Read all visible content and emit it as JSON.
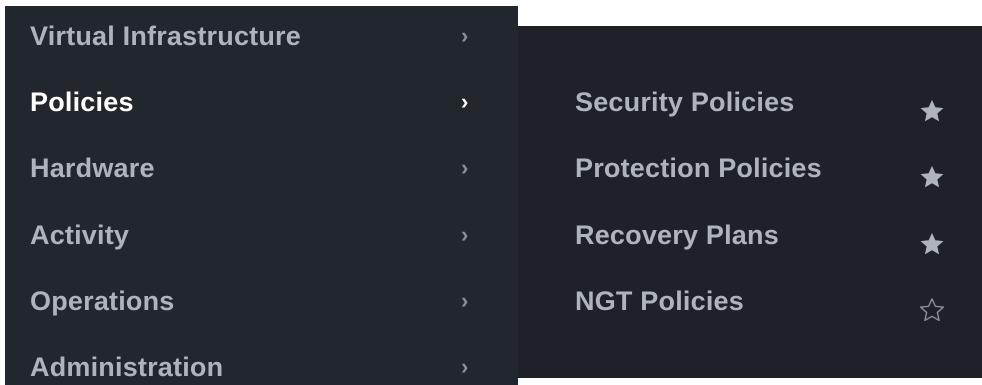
{
  "main_menu": {
    "items": [
      {
        "label": "Virtual Infrastructure",
        "chevron": "›",
        "active": false
      },
      {
        "label": "Policies",
        "chevron": "›",
        "active": true
      },
      {
        "label": "Hardware",
        "chevron": "›",
        "active": false
      },
      {
        "label": "Activity",
        "chevron": "›",
        "active": false
      },
      {
        "label": "Operations",
        "chevron": "›",
        "active": false
      },
      {
        "label": "Administration",
        "chevron": "›",
        "active": false
      }
    ]
  },
  "submenu": {
    "items": [
      {
        "label": "Security Policies",
        "favorite": true,
        "icon": "star-filled-icon"
      },
      {
        "label": "Protection Policies",
        "favorite": true,
        "icon": "star-filled-icon"
      },
      {
        "label": "Recovery Plans",
        "favorite": true,
        "icon": "star-filled-icon"
      },
      {
        "label": "NGT Policies",
        "favorite": false,
        "icon": "star-outline-icon"
      }
    ]
  },
  "colors": {
    "menu_bg": "#22262d",
    "submenu_bg": "#1e2127",
    "text_dim": "#aeb4bc",
    "text_active": "#ffffff",
    "star_filled": "#aeb4bc",
    "star_outline": "#8a9098"
  }
}
